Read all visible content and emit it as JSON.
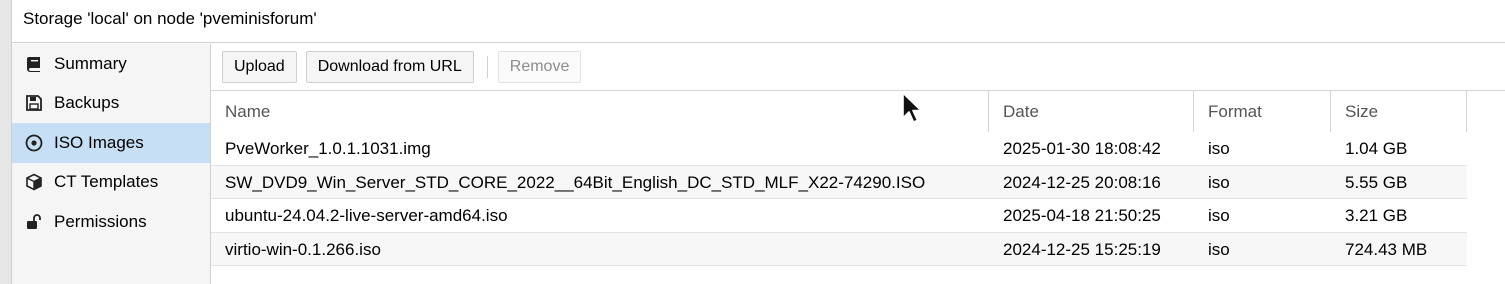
{
  "window": {
    "title": "Storage 'local' on node 'pveminisforum'"
  },
  "sidebar": {
    "items": [
      {
        "label": "Summary",
        "icon": "book-icon",
        "active": false
      },
      {
        "label": "Backups",
        "icon": "floppy-icon",
        "active": false
      },
      {
        "label": "ISO Images",
        "icon": "disc-icon",
        "active": true
      },
      {
        "label": "CT Templates",
        "icon": "cube-icon",
        "active": false
      },
      {
        "label": "Permissions",
        "icon": "unlock-icon",
        "active": false
      }
    ]
  },
  "toolbar": {
    "upload_label": "Upload",
    "download_label": "Download from URL",
    "remove_label": "Remove"
  },
  "table": {
    "columns": [
      "Name",
      "Date",
      "Format",
      "Size"
    ],
    "rows": [
      [
        "PveWorker_1.0.1.1031.img",
        "2025-01-30 18:08:42",
        "iso",
        "1.04 GB"
      ],
      [
        "SW_DVD9_Win_Server_STD_CORE_2022__64Bit_English_DC_STD_MLF_X22-74290.ISO",
        "2024-12-25 20:08:16",
        "iso",
        "5.55 GB"
      ],
      [
        "ubuntu-24.04.2-live-server-amd64.iso",
        "2025-04-18 21:50:25",
        "iso",
        "3.21 GB"
      ],
      [
        "virtio-win-0.1.266.iso",
        "2024-12-25 15:25:19",
        "iso",
        "724.43 MB"
      ]
    ]
  },
  "colors": {
    "selected_nav": "#c7dff5",
    "border": "#cfcfcf"
  }
}
